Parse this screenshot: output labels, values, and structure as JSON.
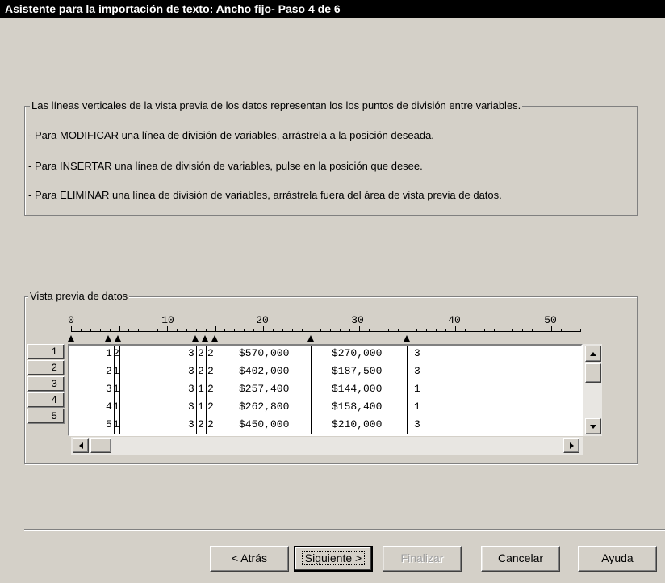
{
  "window": {
    "title": "Asistente para la importación de texto: Ancho fijo- Paso 4 de 6"
  },
  "instructions": {
    "line1": "Las líneas verticales de la vista previa de los  datos representan los los puntos de división entre variables.",
    "line2": "- Para MODIFICAR una línea de división de variables, arrástrela a la posición deseada.",
    "line3": "- Para INSERTAR una línea de división de variables, pulse en la posición que desee.",
    "line4": "- Para ELIMINAR una línea de división de variables, arrástrela fuera del área de vista previa de datos."
  },
  "preview": {
    "label": "Vista previa de datos",
    "ruler_labels": [
      "0",
      "10",
      "20",
      "30",
      "40",
      "50"
    ],
    "row_numbers": [
      "1",
      "2",
      "3",
      "4",
      "5"
    ],
    "rows": [
      {
        "c1": "1",
        "c2": "2",
        "c3": "3",
        "c4": "2",
        "c5": "2",
        "c6": "$570,000",
        "c7": "$270,000",
        "c8": "3"
      },
      {
        "c1": "2",
        "c2": "1",
        "c3": "3",
        "c4": "2",
        "c5": "2",
        "c6": "$402,000",
        "c7": "$187,500",
        "c8": "3"
      },
      {
        "c1": "3",
        "c2": "1",
        "c3": "3",
        "c4": "1",
        "c5": "2",
        "c6": "$257,400",
        "c7": "$144,000",
        "c8": "1"
      },
      {
        "c1": "4",
        "c2": "1",
        "c3": "3",
        "c4": "1",
        "c5": "2",
        "c6": "$262,800",
        "c7": "$158,400",
        "c8": "1"
      },
      {
        "c1": "5",
        "c2": "1",
        "c3": "3",
        "c4": "2",
        "c5": "2",
        "c6": "$450,000",
        "c7": "$210,000",
        "c8": "3"
      }
    ]
  },
  "buttons": {
    "back": "< Atrás",
    "next": "Siguiente >",
    "finish": "Finalizar",
    "cancel": "Cancelar",
    "help": "Ayuda"
  }
}
